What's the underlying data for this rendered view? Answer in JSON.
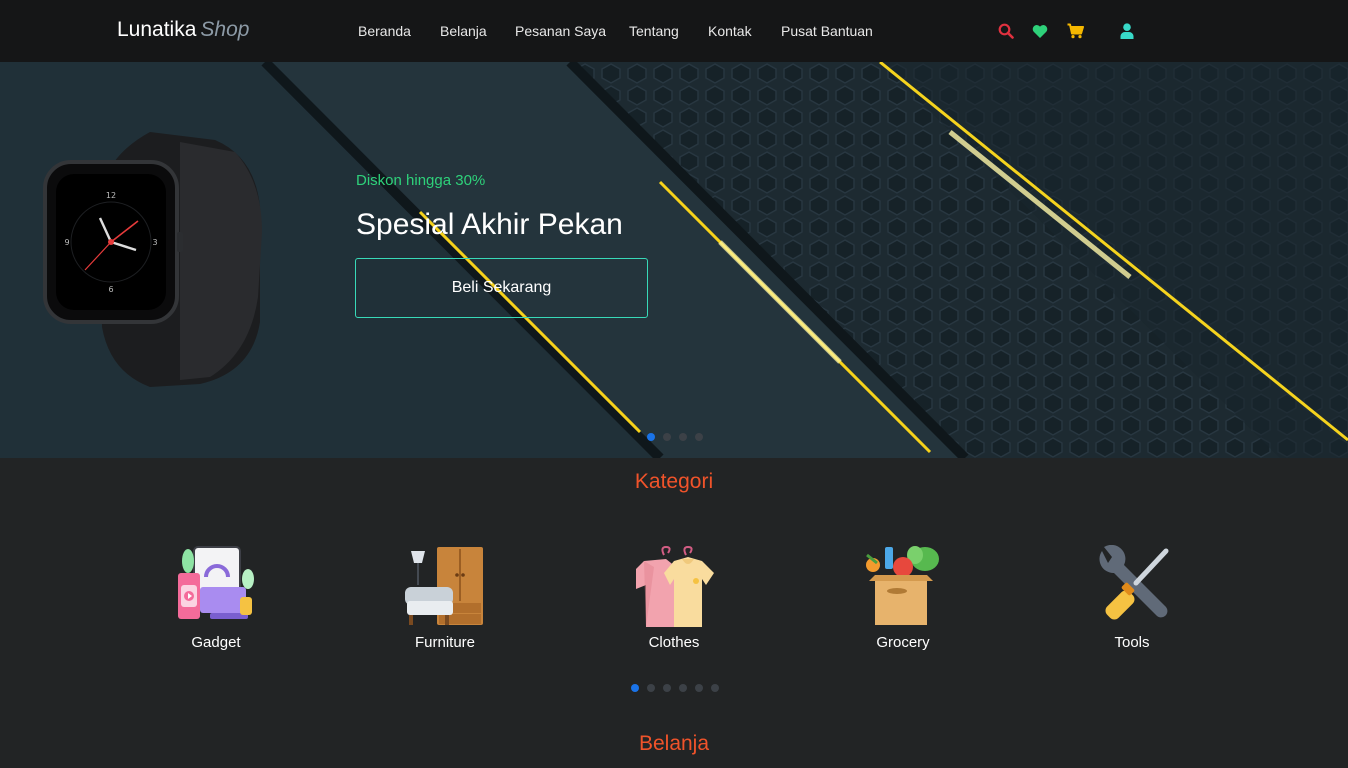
{
  "brand": {
    "name": "Lunatika",
    "accent": "Shop"
  },
  "nav": {
    "links": [
      {
        "label": "Beranda"
      },
      {
        "label": "Belanja"
      },
      {
        "label": "Pesanan Saya"
      },
      {
        "label": "Tentang"
      },
      {
        "label": "Kontak"
      },
      {
        "label": "Pusat Bantuan"
      }
    ],
    "icons": [
      {
        "name": "search-icon",
        "color": "#e0313f"
      },
      {
        "name": "heart-icon",
        "color": "#2ed17a"
      },
      {
        "name": "cart-icon",
        "color": "#f5b800"
      },
      {
        "name": "user-icon",
        "color": "#38d9c8"
      }
    ]
  },
  "hero": {
    "subtitle": "Diskon hingga 30%",
    "title": "Spesial Akhir Pekan",
    "button_label": "Beli Sekarang",
    "slide_count": 4,
    "active_slide": 1
  },
  "categories": {
    "title": "Kategori",
    "items": [
      {
        "label": "Gadget",
        "icon": "gadget-icon"
      },
      {
        "label": "Furniture",
        "icon": "furniture-icon"
      },
      {
        "label": "Clothes",
        "icon": "clothes-icon"
      },
      {
        "label": "Grocery",
        "icon": "grocery-icon"
      },
      {
        "label": "Tools",
        "icon": "tools-icon"
      }
    ],
    "page_count": 6,
    "active_page": 1
  },
  "shop": {
    "title": "Belanja"
  },
  "colors": {
    "accent": "#f0532a",
    "hero_highlight": "#2ed17a",
    "button_border": "#38d9b8",
    "active_dot": "#1a73e8"
  }
}
